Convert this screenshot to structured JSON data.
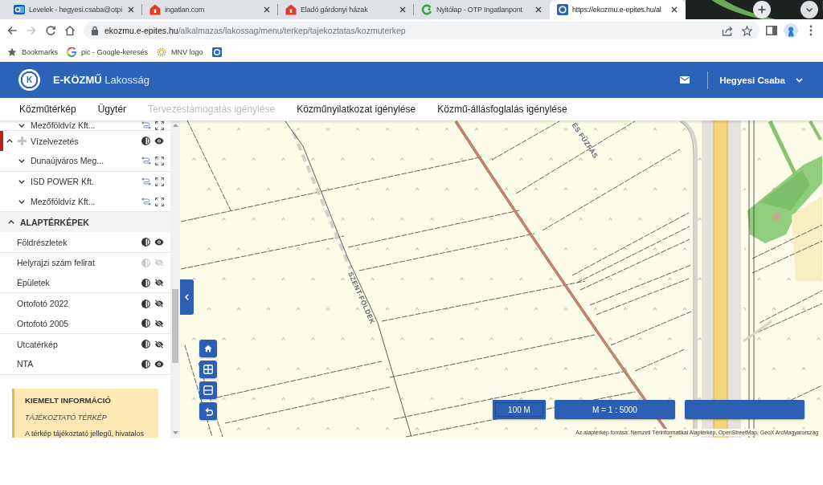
{
  "browser": {
    "tabs": [
      {
        "kind": "mail",
        "title": "Levelek - hegyesi.csaba@otpi",
        "selected": false
      },
      {
        "kind": "house",
        "title": "ingatlan.com",
        "selected": false
      },
      {
        "kind": "house",
        "title": "Eladó gárdonyi házak",
        "selected": false
      },
      {
        "kind": "ring",
        "title": "Nyitólap - OTP Ingatlanpont",
        "selected": false
      },
      {
        "kind": "site",
        "title": "https://ekozmu.e-epites.hu/al",
        "selected": true
      }
    ],
    "toolbar": {
      "can_go_forward": false,
      "url_host": "ekozmu.e-epites.hu",
      "url_path": "/alkalmazas/lakossag/menu/terkep/tajekoztatas/kozmuterkep"
    },
    "bookmarks": [
      {
        "kind": "star",
        "label": "Bookmarks"
      },
      {
        "kind": "google",
        "label": "pic - Google-keresés"
      },
      {
        "kind": "dots",
        "label": "MNV logo"
      },
      {
        "kind": "site"
      }
    ]
  },
  "app": {
    "logo_letter": "K",
    "title": "**E-KÖZMŰ** Lakosság",
    "user": "Hegyesi Csaba"
  },
  "nav": [
    {
      "label": "Közműtérkép",
      "disabled": false
    },
    {
      "label": "Ügytér",
      "disabled": false
    },
    {
      "label": "Tervezéstámogatás igénylése",
      "disabled": true
    },
    {
      "label": "Közműnyilatkozat igénylése",
      "disabled": false
    },
    {
      "label": "Közmű-állásfoglalás igénylése",
      "disabled": false
    }
  ],
  "sidebar": {
    "tree": [
      {
        "kind": "provider",
        "label": "Mezőföldvíz Kft...",
        "expanded": false
      },
      {
        "kind": "category",
        "label": "Vízelvezetés",
        "color": "#b3261e",
        "expanded": true,
        "visible": true,
        "children": [
          {
            "kind": "provider",
            "label": "Dunaújváros Meg...",
            "expanded": false
          },
          {
            "kind": "provider",
            "label": "ISD POWER Kft.",
            "expanded": false
          },
          {
            "kind": "provider",
            "label": "Mezőföldvíz Kft...",
            "expanded": false
          }
        ]
      }
    ],
    "base_maps": {
      "title": "ALAPTÉRKÉPEK",
      "expanded": true,
      "layers": [
        {
          "label": "Földrészletek",
          "visible": true,
          "disabled": false
        },
        {
          "label": "Helyrajzi szám felirat",
          "visible": false,
          "disabled": true
        },
        {
          "label": "Épületek",
          "visible": false,
          "disabled": false
        },
        {
          "label": "Ortofotó 2022",
          "visible": false,
          "disabled": false
        },
        {
          "label": "Ortofotó 2005",
          "visible": false,
          "disabled": false
        },
        {
          "label": "Utcatérkép",
          "visible": false,
          "disabled": false
        },
        {
          "label": "NTA",
          "visible": true,
          "disabled": false
        }
      ]
    },
    "info": {
      "title": "KIEMELT INFORMÁCIÓ",
      "subtitle": "TÁJÉKOZTATÓ TÉRKÉP",
      "text": "A térkép tájékoztató jellegű, hivatalos"
    }
  },
  "map": {
    "labels": [
      "SZENT-FÖLDEK",
      "ÉS FŰZFÁS"
    ],
    "scale_bar": "100 M",
    "scale": "M = 1 : 5000",
    "attribution": "Az alaptérkép forrása: Nemzeti Térinformatikai Alaptérkép, OpenStreetMap, GeoX ArcMagyarország"
  }
}
